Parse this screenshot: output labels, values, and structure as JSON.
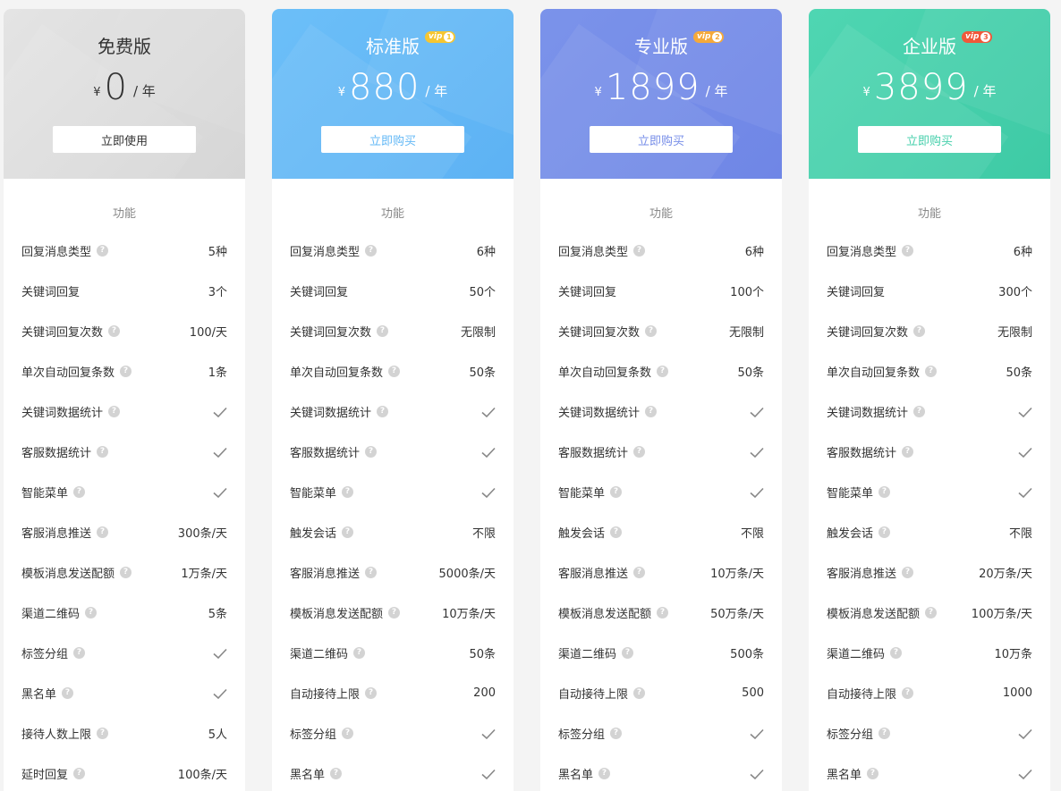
{
  "plans": [
    {
      "name": "免费版",
      "currency": "¥",
      "price": "0",
      "period": "/ 年",
      "button_label": "立即使用",
      "vip_text": "",
      "vip_level": "",
      "features_title": "功能",
      "theme": "#dcdcdc",
      "button_color": "#333333",
      "features": [
        {
          "label": "回复消息类型",
          "help": true,
          "value": "5种"
        },
        {
          "label": "关键词回复",
          "help": false,
          "value": "3个"
        },
        {
          "label": "关键词回复次数",
          "help": true,
          "value": "100/天"
        },
        {
          "label": "单次自动回复条数",
          "help": true,
          "value": "1条"
        },
        {
          "label": "关键词数据统计",
          "help": true,
          "value": "check"
        },
        {
          "label": "客服数据统计",
          "help": true,
          "value": "check"
        },
        {
          "label": "智能菜单",
          "help": true,
          "value": "check"
        },
        {
          "label": "客服消息推送",
          "help": true,
          "value": "300条/天"
        },
        {
          "label": "模板消息发送配额",
          "help": true,
          "value": "1万条/天"
        },
        {
          "label": "渠道二维码",
          "help": true,
          "value": "5条"
        },
        {
          "label": "标签分组",
          "help": true,
          "value": "check"
        },
        {
          "label": "黑名单",
          "help": true,
          "value": "check"
        },
        {
          "label": "接待人数上限",
          "help": true,
          "value": "5人"
        },
        {
          "label": "延时回复",
          "help": true,
          "value": "100条/天"
        }
      ]
    },
    {
      "name": "标准版",
      "currency": "¥",
      "price": "880",
      "period": "/ 年",
      "button_label": "立即购买",
      "vip_text": "vip",
      "vip_level": "1",
      "vip_color": "#f5c632",
      "features_title": "功能",
      "theme": "#63b8f6",
      "button_color": "#63b8f6",
      "features": [
        {
          "label": "回复消息类型",
          "help": true,
          "value": "6种"
        },
        {
          "label": "关键词回复",
          "help": false,
          "value": "50个"
        },
        {
          "label": "关键词回复次数",
          "help": true,
          "value": "无限制"
        },
        {
          "label": "单次自动回复条数",
          "help": true,
          "value": "50条"
        },
        {
          "label": "关键词数据统计",
          "help": true,
          "value": "check"
        },
        {
          "label": "客服数据统计",
          "help": true,
          "value": "check"
        },
        {
          "label": "智能菜单",
          "help": true,
          "value": "check"
        },
        {
          "label": "触发会话",
          "help": true,
          "value": "不限"
        },
        {
          "label": "客服消息推送",
          "help": true,
          "value": "5000条/天"
        },
        {
          "label": "模板消息发送配额",
          "help": true,
          "value": "10万条/天"
        },
        {
          "label": "渠道二维码",
          "help": true,
          "value": "50条"
        },
        {
          "label": "自动接待上限",
          "help": true,
          "value": "200"
        },
        {
          "label": "标签分组",
          "help": true,
          "value": "check"
        },
        {
          "label": "黑名单",
          "help": true,
          "value": "check"
        }
      ]
    },
    {
      "name": "专业版",
      "currency": "¥",
      "price": "1899",
      "period": "/ 年",
      "button_label": "立即购买",
      "vip_text": "vip",
      "vip_level": "2",
      "vip_color": "#f5a93a",
      "features_title": "功能",
      "theme": "#768de8",
      "button_color": "#768de8",
      "features": [
        {
          "label": "回复消息类型",
          "help": true,
          "value": "6种"
        },
        {
          "label": "关键词回复",
          "help": false,
          "value": "100个"
        },
        {
          "label": "关键词回复次数",
          "help": true,
          "value": "无限制"
        },
        {
          "label": "单次自动回复条数",
          "help": true,
          "value": "50条"
        },
        {
          "label": "关键词数据统计",
          "help": true,
          "value": "check"
        },
        {
          "label": "客服数据统计",
          "help": true,
          "value": "check"
        },
        {
          "label": "智能菜单",
          "help": true,
          "value": "check"
        },
        {
          "label": "触发会话",
          "help": true,
          "value": "不限"
        },
        {
          "label": "客服消息推送",
          "help": true,
          "value": "10万条/天"
        },
        {
          "label": "模板消息发送配额",
          "help": true,
          "value": "50万条/天"
        },
        {
          "label": "渠道二维码",
          "help": true,
          "value": "500条"
        },
        {
          "label": "自动接待上限",
          "help": true,
          "value": "500"
        },
        {
          "label": "标签分组",
          "help": true,
          "value": "check"
        },
        {
          "label": "黑名单",
          "help": true,
          "value": "check"
        }
      ]
    },
    {
      "name": "企业版",
      "currency": "¥",
      "price": "3899",
      "period": "/ 年",
      "button_label": "立即购买",
      "vip_text": "vip",
      "vip_level": "3",
      "vip_color": "#f0583a",
      "features_title": "功能",
      "theme": "#45cfab",
      "button_color": "#45cfab",
      "features": [
        {
          "label": "回复消息类型",
          "help": true,
          "value": "6种"
        },
        {
          "label": "关键词回复",
          "help": false,
          "value": "300个"
        },
        {
          "label": "关键词回复次数",
          "help": true,
          "value": "无限制"
        },
        {
          "label": "单次自动回复条数",
          "help": true,
          "value": "50条"
        },
        {
          "label": "关键词数据统计",
          "help": true,
          "value": "check"
        },
        {
          "label": "客服数据统计",
          "help": true,
          "value": "check"
        },
        {
          "label": "智能菜单",
          "help": true,
          "value": "check"
        },
        {
          "label": "触发会话",
          "help": true,
          "value": "不限"
        },
        {
          "label": "客服消息推送",
          "help": true,
          "value": "20万条/天"
        },
        {
          "label": "模板消息发送配额",
          "help": true,
          "value": "100万条/天"
        },
        {
          "label": "渠道二维码",
          "help": true,
          "value": "10万条"
        },
        {
          "label": "自动接待上限",
          "help": true,
          "value": "1000"
        },
        {
          "label": "标签分组",
          "help": true,
          "value": "check"
        },
        {
          "label": "黑名单",
          "help": true,
          "value": "check"
        }
      ]
    }
  ]
}
